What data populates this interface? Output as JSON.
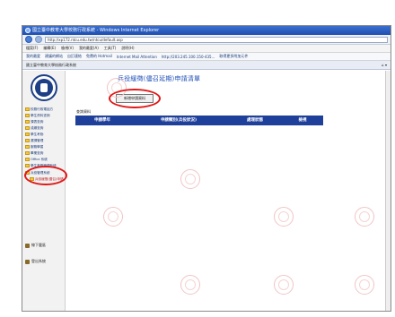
{
  "window": {
    "title": "國立臺中教育大學校務行政系統 - Windows Internet Explorer",
    "url": "http://xp172.ntcu.edu.tw/ntcu/default.asp"
  },
  "menubar": [
    "檔案(F)",
    "編輯(E)",
    "檢視(V)",
    "我的最愛(A)",
    "工具(T)",
    "說明(H)"
  ],
  "favorites": [
    "我的最愛",
    "建議的網站",
    "自訂連結",
    "免費的 Hotmail",
    "Internet Mail Attention",
    "http://203.245.100.150-435...",
    "取得更多附加元件"
  ],
  "tab": {
    "label": "國立臺中教育大學校務行政系統"
  },
  "sidebar": {
    "items": [
      {
        "label": "校務行政電話方",
        "sub": false
      },
      {
        "label": "學生資料查詢",
        "sub": false
      },
      {
        "label": "課表查詢",
        "sub": false
      },
      {
        "label": "成績查詢",
        "sub": false
      },
      {
        "label": "學生考勤",
        "sub": false
      },
      {
        "label": "選課管理",
        "sub": false
      },
      {
        "label": "服務學習",
        "sub": false
      },
      {
        "label": "畢業查詢",
        "sub": false
      },
      {
        "label": "Office 系統",
        "sub": false
      },
      {
        "label": "學生事務管理系統",
        "sub": false
      },
      {
        "label": "兵役管理系統",
        "sub": false
      },
      {
        "label": "兵役緩徵(儘召)申請",
        "sub": true
      }
    ],
    "bottom": [
      {
        "label": "線下載區"
      },
      {
        "label": "登出系統"
      }
    ]
  },
  "main": {
    "title": "兵役緩徵(儘召延期)申請清單",
    "apply_button": "新增申請資料",
    "query_label": "查詢資料",
    "columns": [
      "申請學年",
      "申請類別(兵役狀況)",
      "處理狀態",
      "檢視"
    ]
  },
  "colors": {
    "header_blue": "#1e3f9a",
    "title_blue": "#1f4fb8",
    "highlight_red": "#e01818"
  }
}
